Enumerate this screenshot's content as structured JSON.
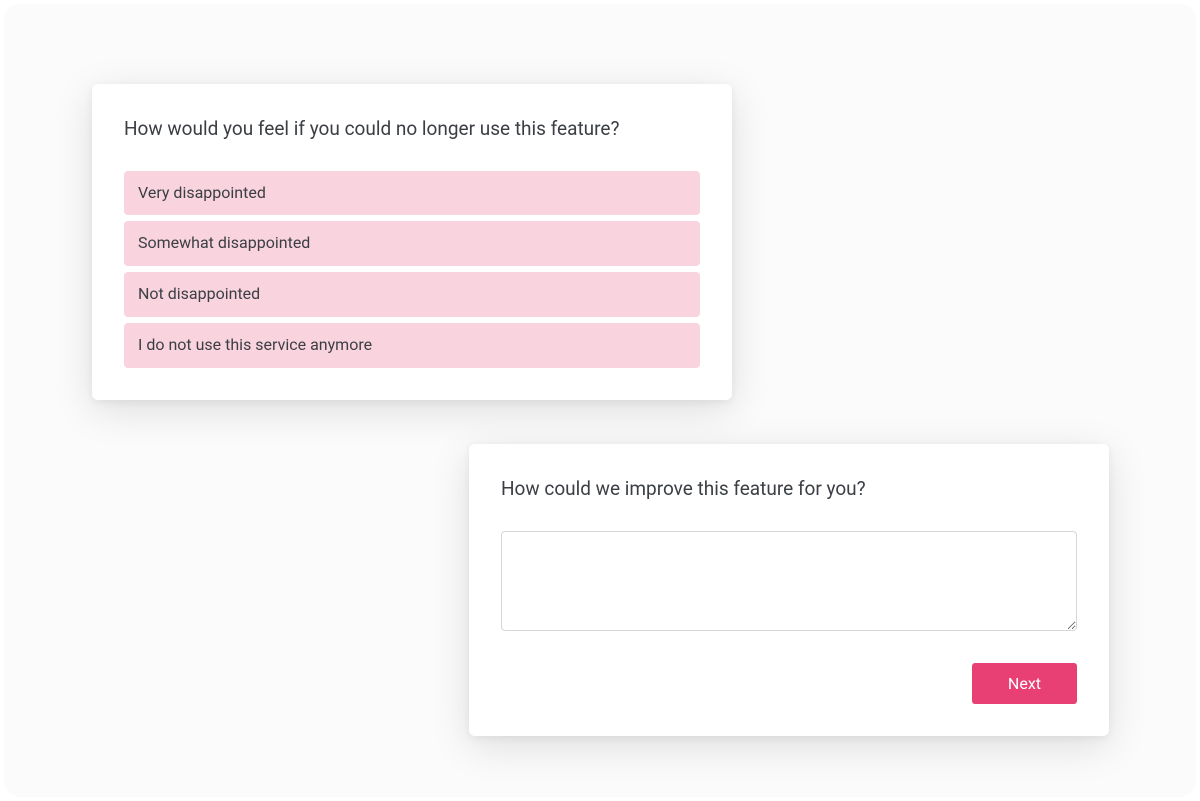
{
  "survey1": {
    "question": "How would you feel if you could no longer use this feature?",
    "options": [
      "Very disappointed",
      "Somewhat disappointed",
      "Not disappointed",
      "I do not use this service anymore"
    ]
  },
  "survey2": {
    "question": "How could we improve this feature for you?",
    "textarea_value": "",
    "next_label": "Next"
  }
}
